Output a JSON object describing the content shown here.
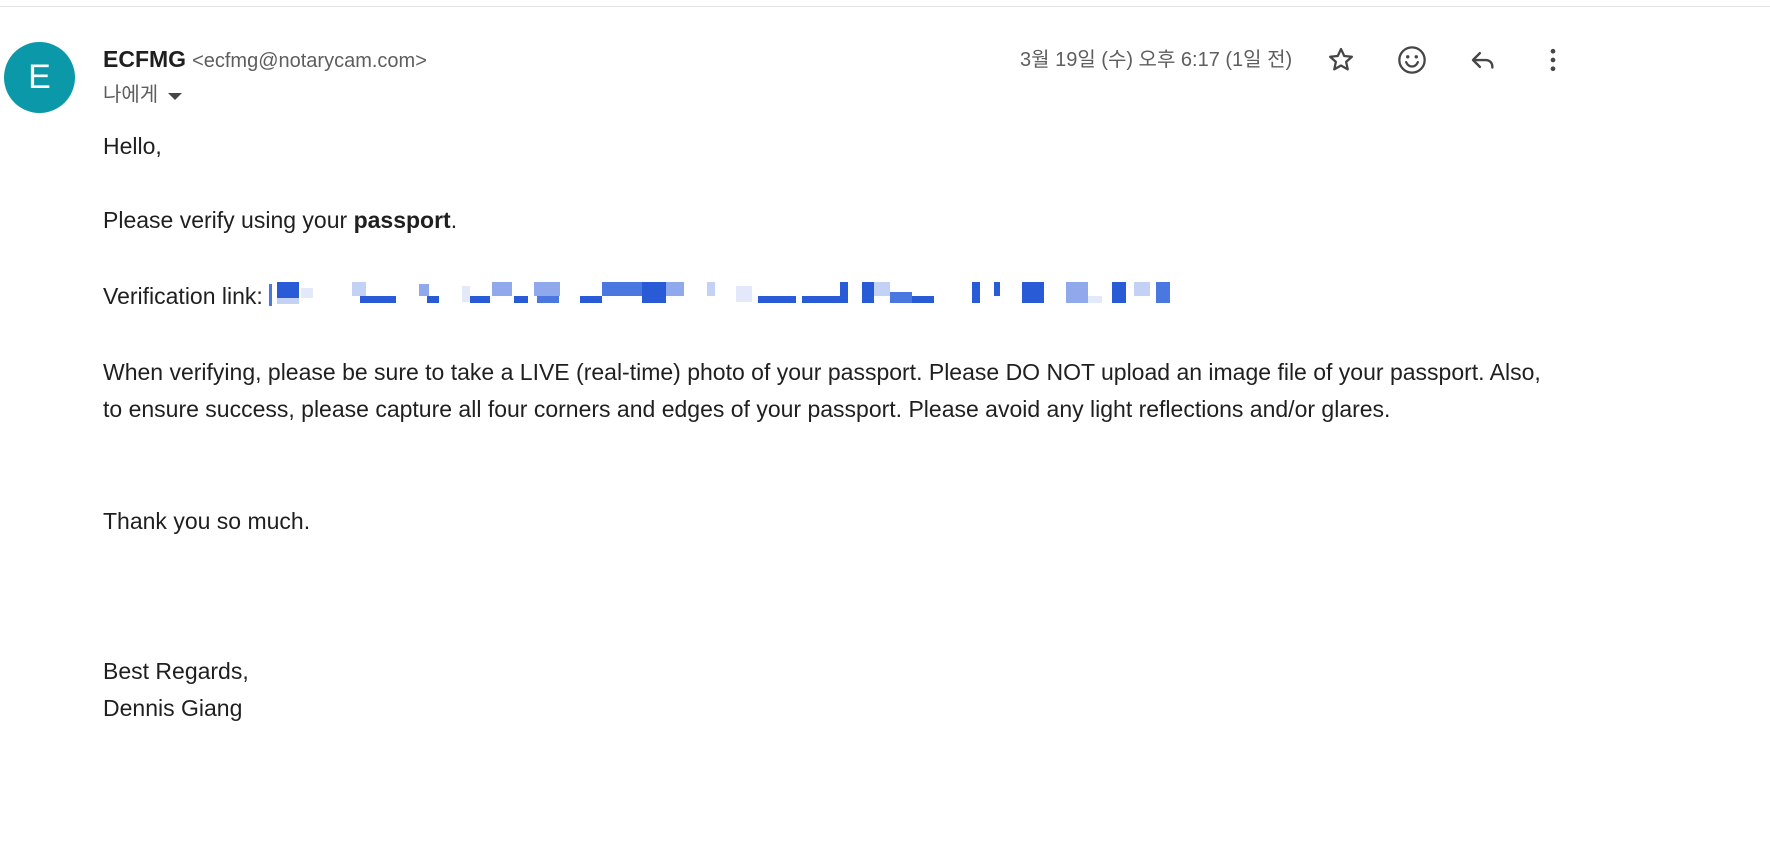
{
  "sender": {
    "avatar_letter": "E",
    "name": "ECFMG",
    "email": "<ecfmg@notarycam.com>",
    "recipient_label": "나에게"
  },
  "meta": {
    "timestamp": "3월 19일 (수) 오후 6:17 (1일 전)"
  },
  "actions": {
    "star_icon": "star-icon",
    "emoji_icon": "emoji-icon",
    "reply_icon": "reply-icon",
    "more_icon": "more-vert-icon"
  },
  "body": {
    "greeting": "Hello,",
    "verify_prefix": "Please verify using your ",
    "verify_bold": "passport",
    "verify_suffix": ".",
    "link_label": "Verification link: ",
    "instructions": "When verifying, please be sure to take a LIVE (real-time) photo of your passport. Please DO NOT upload an image file of your passport. Also, to ensure success, please capture all four corners and edges of your passport. Please avoid any light reflections and/or glares.",
    "thanks": "Thank you so much.",
    "sign_off": "Best Regards,",
    "signature": "Dennis Giang"
  },
  "colors": {
    "avatar_bg": "#0b98a8",
    "link_blue": "#2a5bd7",
    "muted_text": "#5e5e5e"
  }
}
